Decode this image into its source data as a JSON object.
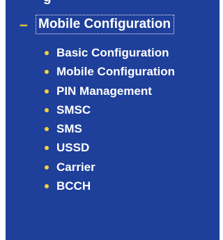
{
  "nav": {
    "partial_item_label": "g",
    "section": {
      "toggle_symbol": "–",
      "label": "Mobile Configuration",
      "items": [
        {
          "label": "Basic Configuration"
        },
        {
          "label": "Mobile Configuration"
        },
        {
          "label": "PIN Management"
        },
        {
          "label": "SMSC"
        },
        {
          "label": "SMS"
        },
        {
          "label": "USSD"
        },
        {
          "label": "Carrier"
        },
        {
          "label": "BCCH"
        }
      ]
    },
    "colors": {
      "background": "#1e3f9a",
      "accent": "#f4d23c",
      "text": "#ffffff"
    }
  }
}
